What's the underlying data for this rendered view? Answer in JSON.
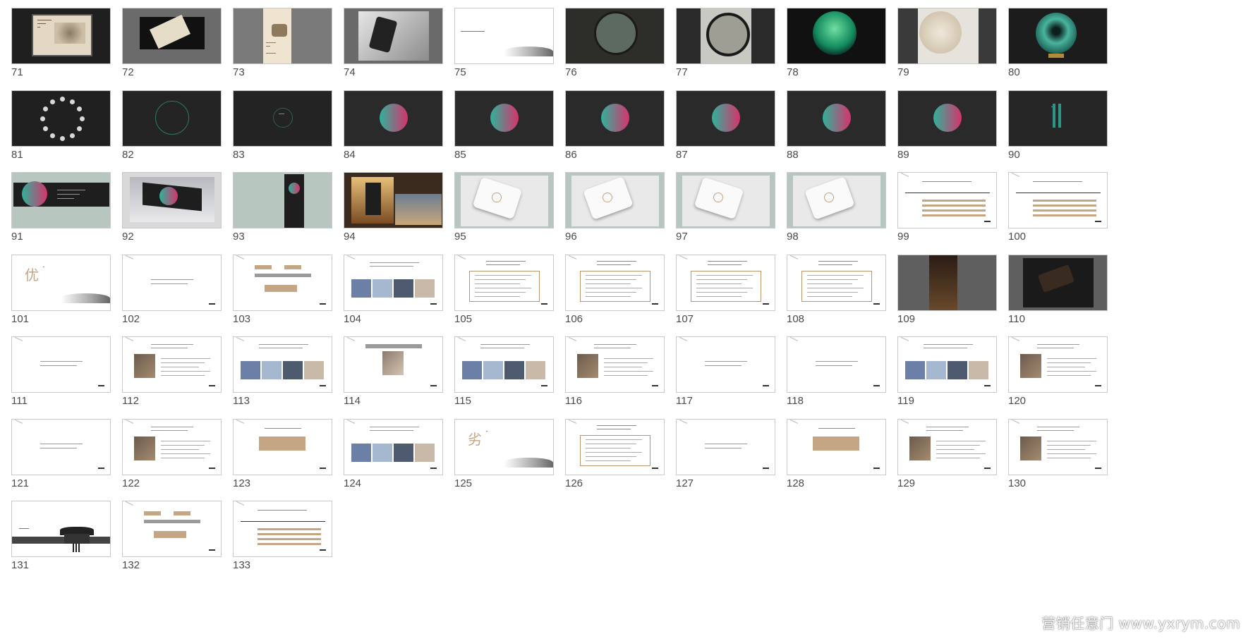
{
  "slides": [
    {
      "n": "71",
      "kind": "billboard"
    },
    {
      "n": "72",
      "kind": "phone-tilt"
    },
    {
      "n": "73",
      "kind": "poster-tall"
    },
    {
      "n": "74",
      "kind": "hand-phone"
    },
    {
      "n": "75",
      "kind": "title-ink"
    },
    {
      "n": "76",
      "kind": "moon-gate"
    },
    {
      "n": "77",
      "kind": "round-frame"
    },
    {
      "n": "78",
      "kind": "tree-circle"
    },
    {
      "n": "79",
      "kind": "fan-circle"
    },
    {
      "n": "80",
      "kind": "teal-disc"
    },
    {
      "n": "81",
      "kind": "moon-ring"
    },
    {
      "n": "82",
      "kind": "dark-ring"
    },
    {
      "n": "83",
      "kind": "dark-text"
    },
    {
      "n": "84",
      "kind": "gradient-orb"
    },
    {
      "n": "85",
      "kind": "gradient-orb"
    },
    {
      "n": "86",
      "kind": "gradient-orb"
    },
    {
      "n": "87",
      "kind": "gradient-orb"
    },
    {
      "n": "88",
      "kind": "gradient-orb"
    },
    {
      "n": "89",
      "kind": "gradient-orb"
    },
    {
      "n": "90",
      "kind": "dark-vertical-text"
    },
    {
      "n": "91",
      "kind": "banner-orb"
    },
    {
      "n": "92",
      "kind": "sky-billboard"
    },
    {
      "n": "93",
      "kind": "sage-poster"
    },
    {
      "n": "94",
      "kind": "bus-stop"
    },
    {
      "n": "95",
      "kind": "product-box"
    },
    {
      "n": "96",
      "kind": "product-box"
    },
    {
      "n": "97",
      "kind": "product-box"
    },
    {
      "n": "98",
      "kind": "product-box"
    },
    {
      "n": "99",
      "kind": "doc-timeline"
    },
    {
      "n": "100",
      "kind": "doc-timeline"
    },
    {
      "n": "101",
      "kind": "big-char"
    },
    {
      "n": "102",
      "kind": "doc-plain"
    },
    {
      "n": "103",
      "kind": "doc-diagram"
    },
    {
      "n": "104",
      "kind": "doc-photos"
    },
    {
      "n": "105",
      "kind": "doc-box"
    },
    {
      "n": "106",
      "kind": "doc-box"
    },
    {
      "n": "107",
      "kind": "doc-box"
    },
    {
      "n": "108",
      "kind": "doc-box"
    },
    {
      "n": "109",
      "kind": "dark-poster"
    },
    {
      "n": "110",
      "kind": "dark-phone"
    },
    {
      "n": "111",
      "kind": "doc-plain"
    },
    {
      "n": "112",
      "kind": "doc-photo"
    },
    {
      "n": "113",
      "kind": "doc-photos"
    },
    {
      "n": "114",
      "kind": "doc-photo-center"
    },
    {
      "n": "115",
      "kind": "doc-photos"
    },
    {
      "n": "116",
      "kind": "doc-photo"
    },
    {
      "n": "117",
      "kind": "doc-plain"
    },
    {
      "n": "118",
      "kind": "doc-plain"
    },
    {
      "n": "119",
      "kind": "doc-photos"
    },
    {
      "n": "120",
      "kind": "doc-photo"
    },
    {
      "n": "121",
      "kind": "doc-plain"
    },
    {
      "n": "122",
      "kind": "doc-photo"
    },
    {
      "n": "123",
      "kind": "doc-tan-box"
    },
    {
      "n": "124",
      "kind": "doc-photos"
    },
    {
      "n": "125",
      "kind": "big-char"
    },
    {
      "n": "126",
      "kind": "doc-box"
    },
    {
      "n": "127",
      "kind": "doc-plain"
    },
    {
      "n": "128",
      "kind": "doc-tan-box"
    },
    {
      "n": "129",
      "kind": "doc-photo"
    },
    {
      "n": "130",
      "kind": "doc-photo"
    },
    {
      "n": "131",
      "kind": "ink-building"
    },
    {
      "n": "132",
      "kind": "doc-diagram"
    },
    {
      "n": "133",
      "kind": "doc-timeline"
    }
  ],
  "big_chars": {
    "101": "优",
    "125": "劣"
  },
  "vertical_text": {
    "90": "壹村苏州",
    "83": "壹村"
  },
  "colors": {
    "dark": "#2b2b2b",
    "sage": "#b7c7c0",
    "tan": "#c4a584",
    "teal": "#2fb29b",
    "magenta": "#d6336c",
    "border": "#c9c9c9"
  },
  "watermark": "营销任意门 www.yxrym.com"
}
